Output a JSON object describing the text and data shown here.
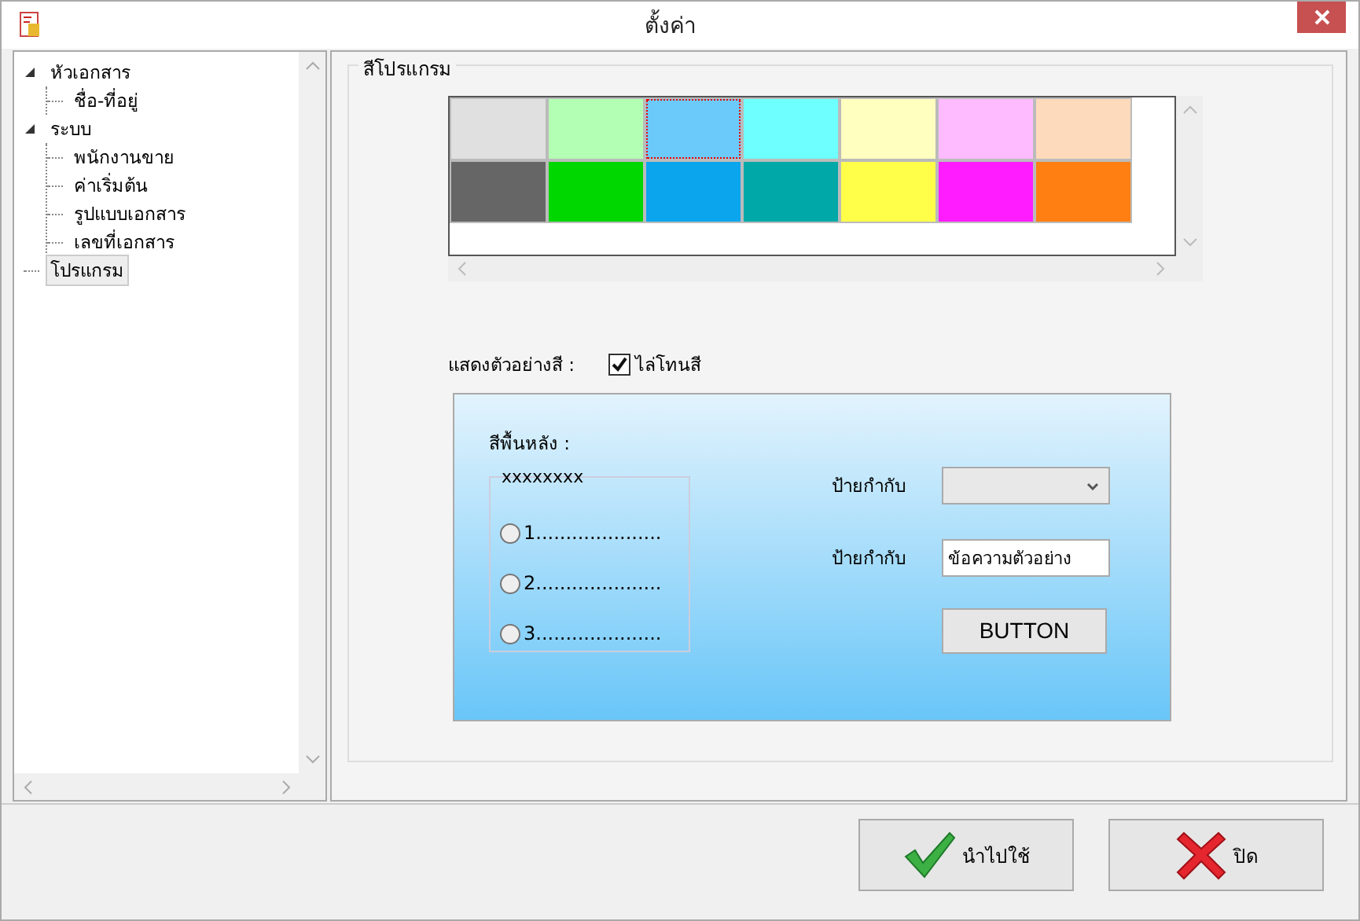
{
  "window": {
    "title": "ตั้งค่า"
  },
  "tree": [
    {
      "label": "หัวเอกสาร",
      "expanded": true,
      "selected": false,
      "children": [
        {
          "label": "ชื่อ-ที่อยู่",
          "selected": false
        }
      ]
    },
    {
      "label": "ระบบ",
      "expanded": true,
      "selected": false,
      "children": [
        {
          "label": "พนักงานขาย",
          "selected": false
        },
        {
          "label": "ค่าเริ่มต้น",
          "selected": false
        },
        {
          "label": "รูปแบบเอกสาร",
          "selected": false
        },
        {
          "label": "เลขที่เอกสาร",
          "selected": false
        }
      ]
    },
    {
      "label": "โปรแกรม",
      "selected": true
    }
  ],
  "color_group": {
    "title": "สีโปรแกรม",
    "swatches": [
      {
        "color": "#e0e0e0",
        "selected": false
      },
      {
        "color": "#b3ffb3",
        "selected": false
      },
      {
        "color": "#6bcafa",
        "selected": true
      },
      {
        "color": "#6effff",
        "selected": false
      },
      {
        "color": "#ffffc0",
        "selected": false
      },
      {
        "color": "#ffbbff",
        "selected": false
      },
      {
        "color": "#fddabb",
        "selected": false
      },
      {
        "color": "#666666",
        "selected": false
      },
      {
        "color": "#00d600",
        "selected": false
      },
      {
        "color": "#0ba5ee",
        "selected": false
      },
      {
        "color": "#00a8a8",
        "selected": false
      },
      {
        "color": "#ffff4a",
        "selected": false
      },
      {
        "color": "#ff1cff",
        "selected": false
      },
      {
        "color": "#ff7f13",
        "selected": false
      }
    ]
  },
  "preview": {
    "label": "แสดงตัวอย่างสี :",
    "gradient_checkbox": {
      "label": "ไล่โทนสี",
      "checked": true
    },
    "background_label": "สีพื้นหลัง :",
    "radio_group": {
      "title": "xxxxxxxx",
      "options": [
        {
          "label": "1.....................",
          "selected": false
        },
        {
          "label": "2.....................",
          "selected": false
        },
        {
          "label": "3.....................",
          "selected": false
        }
      ]
    },
    "combo_label": "ป้ายกำกับ",
    "text_label": "ป้ายกำกับ",
    "text_value": "ข้อความตัวอย่าง",
    "button": "BUTTON"
  },
  "buttons": [
    {
      "label": "นำไปใช้",
      "kind": "apply"
    },
    {
      "label": "ปิด",
      "kind": "close"
    }
  ]
}
